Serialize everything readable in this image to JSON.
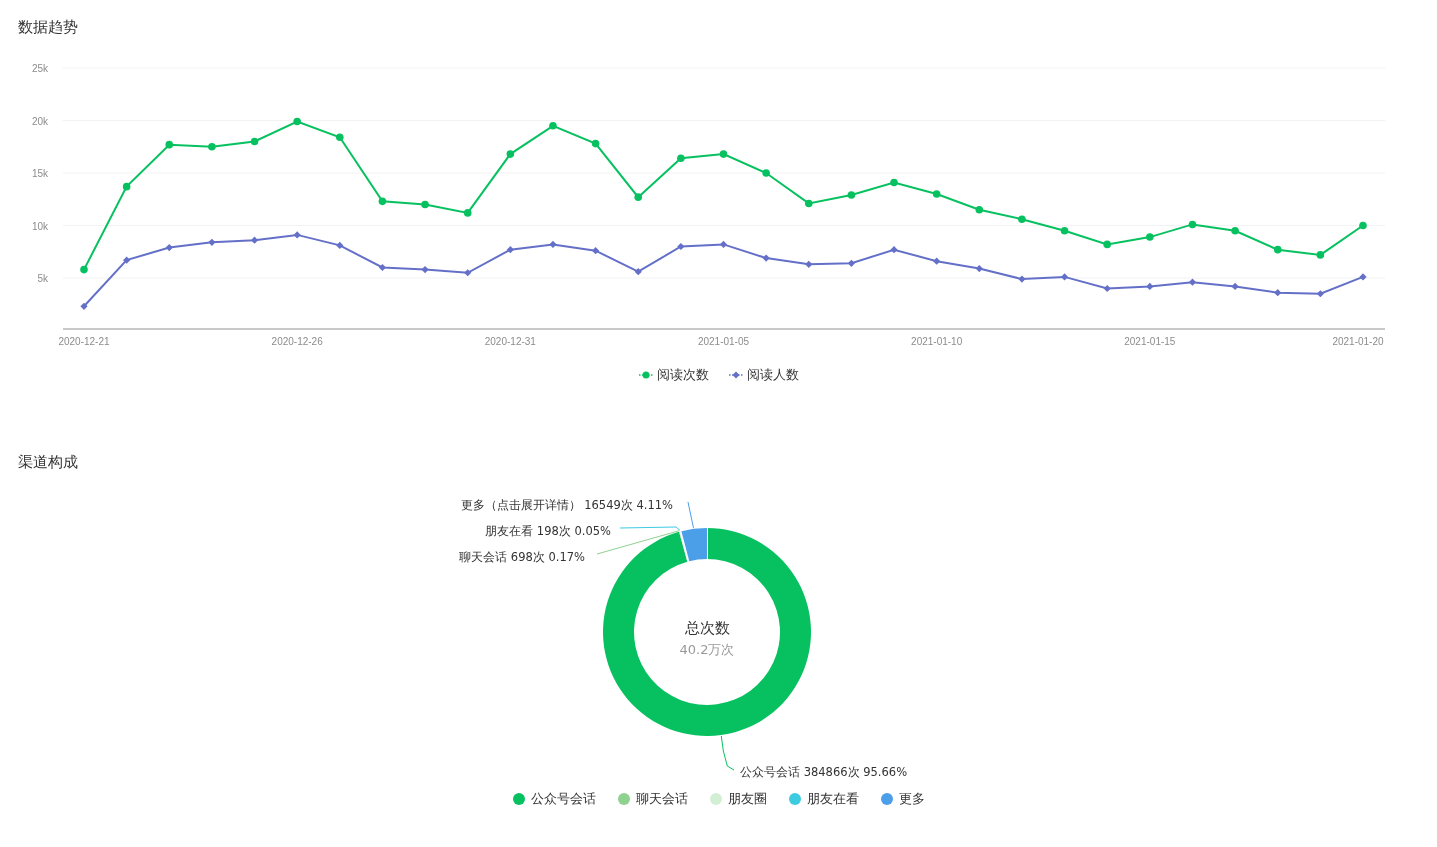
{
  "trend": {
    "title": "数据趋势",
    "chart_data": {
      "type": "line",
      "categories": [
        "2020-12-21",
        null,
        null,
        null,
        null,
        "2020-12-26",
        null,
        null,
        null,
        null,
        "2020-12-31",
        null,
        null,
        null,
        null,
        "2021-01-05",
        null,
        null,
        null,
        null,
        "2021-01-10",
        null,
        null,
        null,
        null,
        "2021-01-15",
        null,
        null,
        null,
        null,
        "2021-01-20"
      ],
      "grid": true,
      "ylim": [
        0,
        25000
      ],
      "yticks": [
        {
          "value": 5000,
          "label": "5k"
        },
        {
          "value": 10000,
          "label": "10k"
        },
        {
          "value": 15000,
          "label": "15k"
        },
        {
          "value": 20000,
          "label": "20k"
        },
        {
          "value": 25000,
          "label": "25k"
        }
      ],
      "series": [
        {
          "name": "阅读次数",
          "color": "#07c160",
          "marker": "circle",
          "values": [
            5800,
            13700,
            17700,
            17500,
            18000,
            19900,
            18400,
            12300,
            12000,
            11200,
            16800,
            19500,
            17800,
            12700,
            16400,
            16800,
            15000,
            12100,
            12900,
            14100,
            13000,
            11500,
            10600,
            9500,
            8200,
            8900,
            10100,
            9500,
            7700,
            7200,
            10000
          ]
        },
        {
          "name": "阅读人数",
          "color": "#6470c8",
          "marker": "diamond",
          "values": [
            2300,
            6700,
            7900,
            8400,
            8600,
            9100,
            8100,
            6000,
            5800,
            5500,
            7700,
            8200,
            7600,
            5600,
            8000,
            8200,
            6900,
            6300,
            6400,
            7700,
            6600,
            5900,
            4900,
            5100,
            4000,
            4200,
            4600,
            4200,
            3600,
            3500,
            5100
          ]
        }
      ]
    }
  },
  "channels": {
    "title": "渠道构成",
    "center_title": "总次数",
    "center_value": "40.2万次",
    "chart_data": {
      "type": "donut",
      "categories": [
        "公众号会话",
        "聊天会话",
        "朋友圈",
        "朋友在看",
        "更多"
      ],
      "colors": [
        "#07c160",
        "#8fd18f",
        "#d3efd3",
        "#3ccbe0",
        "#4b9ee8"
      ],
      "values": [
        384866,
        698,
        0,
        198,
        16549
      ],
      "value_labels": [
        "公众号会话 384866次 95.66%",
        "聊天会话 698次 0.17%",
        null,
        "朋友在看 198次 0.05%",
        "更多（点击展开详情） 16549次 4.11%"
      ]
    }
  }
}
